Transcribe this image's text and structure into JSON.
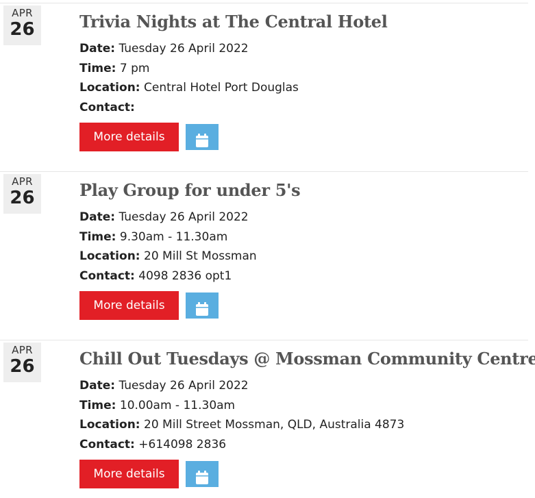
{
  "events": [
    {
      "month": "APR",
      "day": "26",
      "title": "Trivia Nights at The Central Hotel",
      "date_label": "Date:",
      "date": "Tuesday 26 April 2022",
      "time_label": "Time:",
      "time": "7 pm",
      "location_label": "Location:",
      "location": "Central Hotel Port Douglas",
      "contact_label": "Contact:",
      "contact": "",
      "more_label": "More details",
      "calendar_icon": "calendar-icon"
    },
    {
      "month": "APR",
      "day": "26",
      "title": "Play Group for under 5's",
      "date_label": "Date:",
      "date": "Tuesday 26 April 2022",
      "time_label": "Time:",
      "time": "9.30am - 11.30am",
      "location_label": "Location:",
      "location": "20 Mill St Mossman",
      "contact_label": "Contact:",
      "contact": "4098 2836 opt1",
      "more_label": "More details",
      "calendar_icon": "calendar-icon"
    },
    {
      "month": "APR",
      "day": "26",
      "title": "Chill Out Tuesdays @ Mossman Community Centre",
      "date_label": "Date:",
      "date": "Tuesday 26 April 2022",
      "time_label": "Time:",
      "time": "10.00am - 11.30am",
      "location_label": "Location:",
      "location": "20 Mill Street Mossman, QLD, Australia 4873",
      "contact_label": "Contact:",
      "contact": "+614098 2836",
      "more_label": "More details",
      "calendar_icon": "calendar-icon"
    }
  ],
  "colors": {
    "more_button": "#e21f26",
    "calendar_button": "#5aaee0",
    "date_badge_bg": "#eeeeee",
    "title_text": "#555555"
  }
}
